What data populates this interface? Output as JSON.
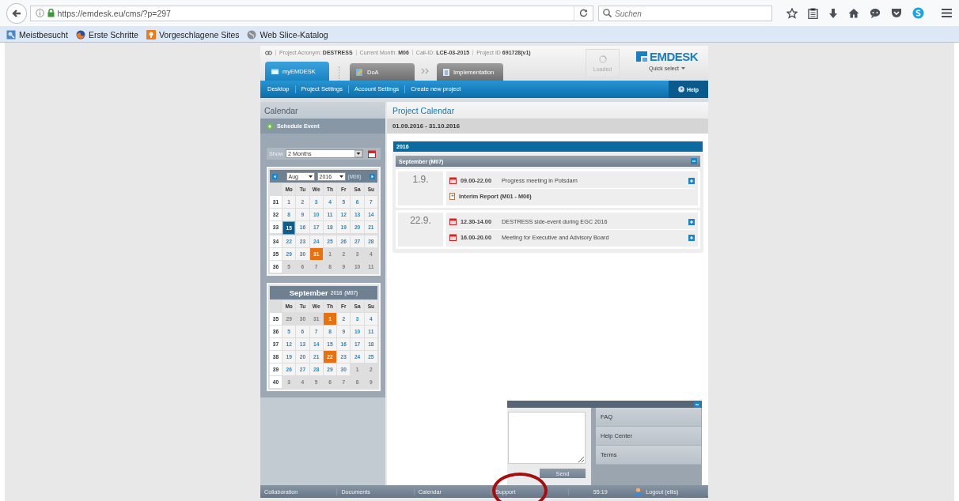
{
  "browser": {
    "url": "https://emdesk.eu/cms/?p=297",
    "search_placeholder": "Suchen",
    "bookmarks": [
      "Meistbesucht",
      "Erste Schritte",
      "Vorgeschlagene Sites",
      "Web Slice-Katalog"
    ]
  },
  "project_info": [
    {
      "label": "Project Acronym:",
      "value": "DESTRESS"
    },
    {
      "label": "Current Month:",
      "value": "M06"
    },
    {
      "label": "Call-ID:",
      "value": "LCE-03-2015"
    },
    {
      "label": "Project ID",
      "value": "691728(v1)"
    }
  ],
  "tabs": [
    {
      "label": "myEMDESK",
      "selected": true
    },
    {
      "label": "DoA",
      "selected": false
    },
    {
      "label": "Implementation",
      "selected": false
    }
  ],
  "loaded": "Loaded",
  "logo": "EMDESK",
  "quick_select": "Quick select",
  "nav": {
    "items": [
      "Desktop",
      "Project Settings",
      "Account Settings",
      "Create new project"
    ],
    "help": "Help"
  },
  "sidebar": {
    "title": "Calendar",
    "action": "Schedule Event",
    "show_label": "Show",
    "show_value": "2 Months",
    "calendars": [
      {
        "kind": "select",
        "month": "Aug",
        "year": "2016",
        "code": "(M06)",
        "weekdays": [
          "Mo",
          "Tu",
          "We",
          "Th",
          "Fr",
          "Sa",
          "Su"
        ],
        "weeks": [
          {
            "week": "31",
            "days": [
              {
                "day": "1",
                "outside": false,
                "today": false,
                "event": false
              },
              {
                "day": "2",
                "outside": false,
                "today": false,
                "event": false
              },
              {
                "day": "3",
                "outside": false,
                "today": false,
                "event": false
              },
              {
                "day": "4",
                "outside": false,
                "today": false,
                "event": false
              },
              {
                "day": "5",
                "outside": false,
                "today": false,
                "event": false
              },
              {
                "day": "6",
                "outside": false,
                "today": false,
                "event": false
              },
              {
                "day": "7",
                "outside": false,
                "today": false,
                "event": false
              }
            ]
          },
          {
            "week": "32",
            "days": [
              {
                "day": "8",
                "outside": false,
                "today": false,
                "event": false
              },
              {
                "day": "9",
                "outside": false,
                "today": false,
                "event": false
              },
              {
                "day": "10",
                "outside": false,
                "today": false,
                "event": false
              },
              {
                "day": "11",
                "outside": false,
                "today": false,
                "event": false
              },
              {
                "day": "12",
                "outside": false,
                "today": false,
                "event": false
              },
              {
                "day": "13",
                "outside": false,
                "today": false,
                "event": false
              },
              {
                "day": "14",
                "outside": false,
                "today": false,
                "event": false
              }
            ]
          },
          {
            "week": "33",
            "days": [
              {
                "day": "15",
                "outside": false,
                "today": true,
                "event": false
              },
              {
                "day": "16",
                "outside": false,
                "today": false,
                "event": false
              },
              {
                "day": "17",
                "outside": false,
                "today": false,
                "event": false
              },
              {
                "day": "18",
                "outside": false,
                "today": false,
                "event": false
              },
              {
                "day": "19",
                "outside": false,
                "today": false,
                "event": false
              },
              {
                "day": "20",
                "outside": false,
                "today": false,
                "event": false
              },
              {
                "day": "21",
                "outside": false,
                "today": false,
                "event": false
              }
            ]
          },
          {
            "week": "34",
            "days": [
              {
                "day": "22",
                "outside": false,
                "today": false,
                "event": false
              },
              {
                "day": "23",
                "outside": false,
                "today": false,
                "event": false
              },
              {
                "day": "24",
                "outside": false,
                "today": false,
                "event": false
              },
              {
                "day": "25",
                "outside": false,
                "today": false,
                "event": false
              },
              {
                "day": "26",
                "outside": false,
                "today": false,
                "event": false
              },
              {
                "day": "27",
                "outside": false,
                "today": false,
                "event": false
              },
              {
                "day": "28",
                "outside": false,
                "today": false,
                "event": false
              }
            ]
          },
          {
            "week": "35",
            "days": [
              {
                "day": "29",
                "outside": false,
                "today": false,
                "event": false
              },
              {
                "day": "30",
                "outside": false,
                "today": false,
                "event": false
              },
              {
                "day": "31",
                "outside": false,
                "today": false,
                "event": true
              },
              {
                "day": "1",
                "outside": true,
                "today": false,
                "event": false
              },
              {
                "day": "2",
                "outside": true,
                "today": false,
                "event": false
              },
              {
                "day": "3",
                "outside": true,
                "today": false,
                "event": false
              },
              {
                "day": "4",
                "outside": true,
                "today": false,
                "event": false
              }
            ]
          },
          {
            "week": "36",
            "days": [
              {
                "day": "5",
                "outside": true,
                "today": false,
                "event": false
              },
              {
                "day": "6",
                "outside": true,
                "today": false,
                "event": false
              },
              {
                "day": "7",
                "outside": true,
                "today": false,
                "event": false
              },
              {
                "day": "8",
                "outside": true,
                "today": false,
                "event": false
              },
              {
                "day": "9",
                "outside": true,
                "today": false,
                "event": false
              },
              {
                "day": "10",
                "outside": true,
                "today": false,
                "event": false
              },
              {
                "day": "11",
                "outside": true,
                "today": false,
                "event": false
              }
            ]
          }
        ]
      },
      {
        "kind": "title",
        "month": "September",
        "year": "2016",
        "code": "(M07)",
        "weekdays": [
          "Mo",
          "Tu",
          "We",
          "Th",
          "Fr",
          "Sa",
          "Su"
        ],
        "weeks": [
          {
            "week": "35",
            "days": [
              {
                "day": "29",
                "outside": true,
                "today": false,
                "event": false
              },
              {
                "day": "30",
                "outside": true,
                "today": false,
                "event": false
              },
              {
                "day": "31",
                "outside": true,
                "today": false,
                "event": false
              },
              {
                "day": "1",
                "outside": false,
                "today": false,
                "event": true
              },
              {
                "day": "2",
                "outside": false,
                "today": false,
                "event": false
              },
              {
                "day": "3",
                "outside": false,
                "today": false,
                "event": false
              },
              {
                "day": "4",
                "outside": false,
                "today": false,
                "event": false
              }
            ]
          },
          {
            "week": "36",
            "days": [
              {
                "day": "5",
                "outside": false,
                "today": false,
                "event": false
              },
              {
                "day": "6",
                "outside": false,
                "today": false,
                "event": false
              },
              {
                "day": "7",
                "outside": false,
                "today": false,
                "event": false
              },
              {
                "day": "8",
                "outside": false,
                "today": false,
                "event": false
              },
              {
                "day": "9",
                "outside": false,
                "today": false,
                "event": false
              },
              {
                "day": "10",
                "outside": false,
                "today": false,
                "event": false
              },
              {
                "day": "11",
                "outside": false,
                "today": false,
                "event": false
              }
            ]
          },
          {
            "week": "37",
            "days": [
              {
                "day": "12",
                "outside": false,
                "today": false,
                "event": false
              },
              {
                "day": "13",
                "outside": false,
                "today": false,
                "event": false
              },
              {
                "day": "14",
                "outside": false,
                "today": false,
                "event": false
              },
              {
                "day": "15",
                "outside": false,
                "today": false,
                "event": false
              },
              {
                "day": "16",
                "outside": false,
                "today": false,
                "event": false
              },
              {
                "day": "17",
                "outside": false,
                "today": false,
                "event": false
              },
              {
                "day": "18",
                "outside": false,
                "today": false,
                "event": false
              }
            ]
          },
          {
            "week": "38",
            "days": [
              {
                "day": "19",
                "outside": false,
                "today": false,
                "event": false
              },
              {
                "day": "20",
                "outside": false,
                "today": false,
                "event": false
              },
              {
                "day": "21",
                "outside": false,
                "today": false,
                "event": false
              },
              {
                "day": "22",
                "outside": false,
                "today": false,
                "event": true
              },
              {
                "day": "23",
                "outside": false,
                "today": false,
                "event": false
              },
              {
                "day": "24",
                "outside": false,
                "today": false,
                "event": false
              },
              {
                "day": "25",
                "outside": false,
                "today": false,
                "event": false
              }
            ]
          },
          {
            "week": "39",
            "days": [
              {
                "day": "26",
                "outside": false,
                "today": false,
                "event": false
              },
              {
                "day": "27",
                "outside": false,
                "today": false,
                "event": false
              },
              {
                "day": "28",
                "outside": false,
                "today": false,
                "event": false
              },
              {
                "day": "29",
                "outside": false,
                "today": false,
                "event": false
              },
              {
                "day": "30",
                "outside": false,
                "today": false,
                "event": false
              },
              {
                "day": "1",
                "outside": true,
                "today": false,
                "event": false
              },
              {
                "day": "2",
                "outside": true,
                "today": false,
                "event": false
              }
            ]
          },
          {
            "week": "40",
            "days": [
              {
                "day": "3",
                "outside": true,
                "today": false,
                "event": false
              },
              {
                "day": "4",
                "outside": true,
                "today": false,
                "event": false
              },
              {
                "day": "5",
                "outside": true,
                "today": false,
                "event": false
              },
              {
                "day": "6",
                "outside": true,
                "today": false,
                "event": false
              },
              {
                "day": "7",
                "outside": true,
                "today": false,
                "event": false
              },
              {
                "day": "8",
                "outside": true,
                "today": false,
                "event": false
              },
              {
                "day": "9",
                "outside": true,
                "today": false,
                "event": false
              }
            ]
          }
        ]
      }
    ]
  },
  "main": {
    "title": "Project Calendar",
    "range": "01.09.2016 - 31.10.2016",
    "year": "2016",
    "month": "September (M07)",
    "days": [
      {
        "date": "1.9.",
        "entries": [
          {
            "kind": "event",
            "time": "09.00-22.00",
            "title": "Progress meeting in Potsdam"
          },
          {
            "kind": "report",
            "title": "Interim Report (M01 - M06)"
          }
        ]
      },
      {
        "date": "22.9.",
        "entries": [
          {
            "kind": "event",
            "time": "12.30-14.00",
            "title": "DESTRESS side-event during EGC 2016"
          },
          {
            "kind": "event",
            "time": "16.00-20.00",
            "title": "Meeting for Executive and Advisory Board"
          }
        ]
      }
    ]
  },
  "support": {
    "links": [
      "FAQ",
      "Help Center",
      "Terms"
    ],
    "send": "Send"
  },
  "footer": {
    "items": [
      "Collaboration",
      "Documents",
      "Calendar",
      "Support"
    ],
    "time": "55:19",
    "user": "Logout (ellis)"
  }
}
